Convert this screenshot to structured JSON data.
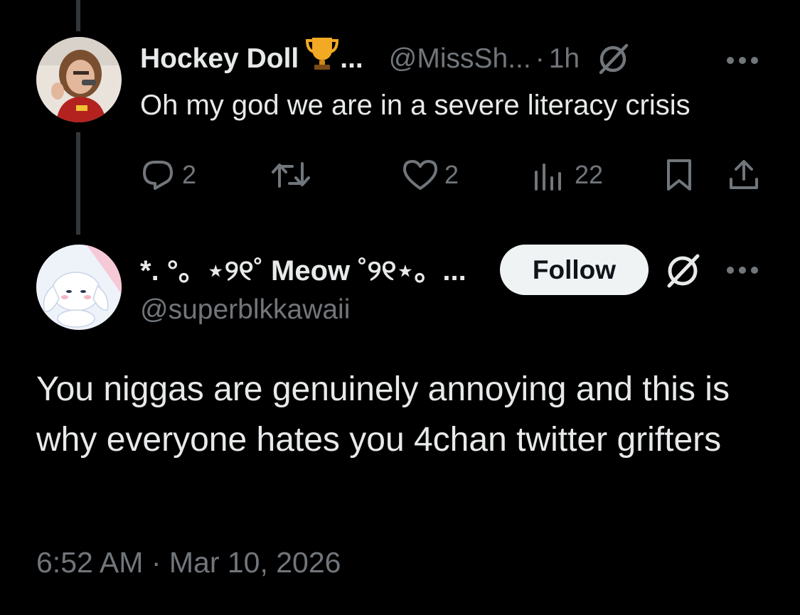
{
  "parent_tweet": {
    "author_name": "Hockey Doll",
    "name_ellipsis": "...",
    "handle": "@MissSh...",
    "separator": "·",
    "time": "1h",
    "text": "Oh my god we are in a severe literacy crisis",
    "actions": {
      "replies": "2",
      "likes": "2",
      "views": "22"
    }
  },
  "reply_tweet": {
    "author_name": "*. °。⋆୨୧˚ Meow ˚୨୧⋆。...",
    "handle": "@superblkkawaii",
    "follow_label": "Follow",
    "text": "You niggas are genuinely annoying and this is why everyone hates you 4chan twitter grifters",
    "timestamp": "6:52 AM · Mar 10, 2026"
  },
  "colors": {
    "background": "#000000",
    "text_primary": "#e7e9ea",
    "text_muted": "#71767b",
    "follow_bg": "#eff3f4",
    "thread_line": "#333639"
  }
}
